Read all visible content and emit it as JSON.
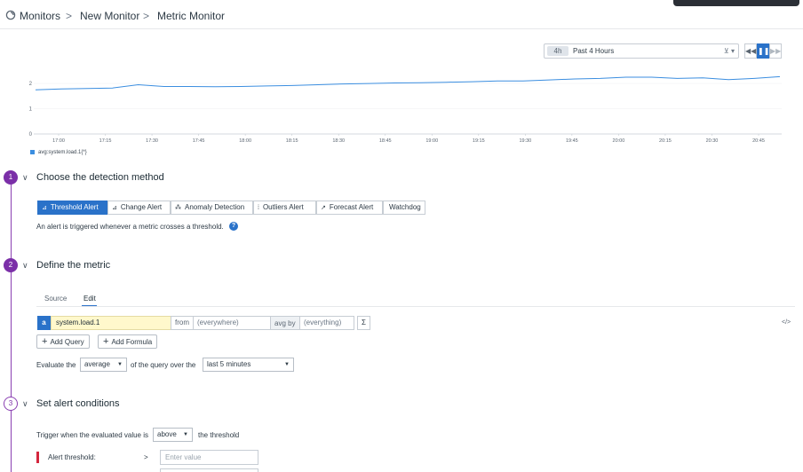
{
  "breadcrumb": {
    "root": "Monitors",
    "sep": ">",
    "mid": "New Monitor",
    "current": "Metric Monitor"
  },
  "timeframe": {
    "badge": "4h",
    "label": "Past 4 Hours"
  },
  "chart_data": {
    "type": "line",
    "x_ticks": [
      "17:00",
      "17:15",
      "17:30",
      "17:45",
      "18:00",
      "18:15",
      "18:30",
      "18:45",
      "19:00",
      "19:15",
      "19:30",
      "19:45",
      "20:00",
      "20:15",
      "20:30",
      "20:45"
    ],
    "y_ticks": [
      "0",
      "1",
      "2"
    ],
    "ylim": [
      0,
      2.6
    ],
    "series": [
      {
        "name": "avg:system.load.1{*}",
        "values": [
          1.75,
          1.78,
          1.8,
          1.82,
          1.95,
          1.88,
          1.88,
          1.87,
          1.88,
          1.9,
          1.92,
          1.95,
          1.98,
          2.0,
          2.02,
          2.03,
          2.05,
          2.07,
          2.1,
          2.1,
          2.14,
          2.18,
          2.2,
          2.25,
          2.25,
          2.2,
          2.22,
          2.15,
          2.2,
          2.27
        ]
      }
    ]
  },
  "sections": {
    "s1": {
      "num": "1",
      "title": "Choose the detection method"
    },
    "s2": {
      "num": "2",
      "title": "Define the metric"
    },
    "s3": {
      "num": "3",
      "title": "Set alert conditions"
    }
  },
  "detection": {
    "tabs": [
      {
        "icon": "⊿",
        "label": "Threshold Alert"
      },
      {
        "icon": "⊿",
        "label": "Change Alert"
      },
      {
        "icon": "⁂",
        "label": "Anomaly Detection"
      },
      {
        "icon": "⁞",
        "label": "Outliers Alert"
      },
      {
        "icon": "↗",
        "label": "Forecast Alert"
      },
      {
        "icon": "",
        "label": "Watchdog"
      }
    ],
    "description": "An alert is triggered whenever a metric crosses a threshold."
  },
  "metric": {
    "tab_source": "Source",
    "tab_edit": "Edit",
    "query_letter": "a",
    "metric_name": "system.load.1",
    "from_label": "from",
    "from_value": "(everywhere)",
    "avg_by_label": "avg by",
    "avg_by_value": "(everything)",
    "sigma": "Σ",
    "code_icon": "</>",
    "add_query": "Add Query",
    "add_formula": "Add Formula",
    "evaluate_prefix": "Evaluate the",
    "evaluate_agg": "average",
    "evaluate_mid": "of the query over the",
    "evaluate_window": "last 5 minutes"
  },
  "conditions": {
    "trigger_prefix": "Trigger when the evaluated value is",
    "trigger_op": "above",
    "trigger_suffix": "the threshold",
    "alert_label": "Alert threshold:",
    "alert_op": ">",
    "alert_placeholder": "Enter value"
  }
}
